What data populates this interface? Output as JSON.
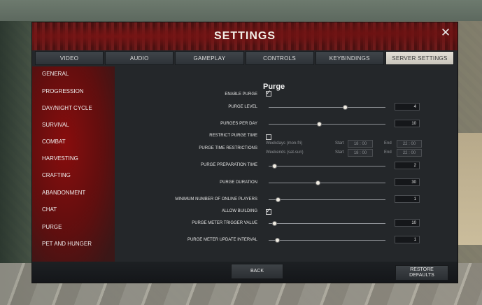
{
  "window": {
    "title": "SETTINGS",
    "close_icon": "✕"
  },
  "tabs": [
    {
      "label": "VIDEO"
    },
    {
      "label": "AUDIO"
    },
    {
      "label": "GAMEPLAY"
    },
    {
      "label": "CONTROLS"
    },
    {
      "label": "KEYBINDINGS"
    },
    {
      "label": "SERVER SETTINGS",
      "active": true
    }
  ],
  "sidebar": {
    "items": [
      {
        "label": "GENERAL"
      },
      {
        "label": "PROGRESSION"
      },
      {
        "label": "DAY/NIGHT CYCLE"
      },
      {
        "label": "SURVIVAL"
      },
      {
        "label": "COMBAT"
      },
      {
        "label": "HARVESTING"
      },
      {
        "label": "CRAFTING"
      },
      {
        "label": "ABANDONMENT"
      },
      {
        "label": "CHAT"
      },
      {
        "label": "PURGE",
        "active": true
      },
      {
        "label": "PET AND HUNGER"
      }
    ]
  },
  "section": {
    "title": "Purge",
    "enable_purge": {
      "label": "ENABLE PURGE",
      "checked": true
    },
    "purge_level": {
      "label": "PURGE LEVEL",
      "value": "4",
      "fraction": 0.65
    },
    "purges_per_day": {
      "label": "PURGES PER DAY",
      "value": "10",
      "fraction": 0.43
    },
    "restrict_purge_time": {
      "label": "RESTRICT PURGE TIME",
      "checked": false
    },
    "purge_time_restrictions": {
      "label": "PURGE TIME RESTRICTIONS",
      "weekdays": {
        "label": "Weekdays (mon-fri)",
        "start_label": "Start",
        "start": "18 : 00",
        "end_label": "End",
        "end": "22 : 00"
      },
      "weekends": {
        "label": "Weekends (sat-sun)",
        "start_label": "Start",
        "start": "18 : 00",
        "end_label": "End",
        "end": "22 : 00"
      }
    },
    "purge_preparation_time": {
      "label": "PURGE PREPARATION TIME",
      "value": "2",
      "fraction": 0.05
    },
    "purge_duration": {
      "label": "PURGE DURATION",
      "value": "30",
      "fraction": 0.42
    },
    "min_online_players": {
      "label": "MINIMUM NUMBER OF ONLINE PLAYERS",
      "value": "1",
      "fraction": 0.08
    },
    "allow_building": {
      "label": "ALLOW BUILDING",
      "checked": true
    },
    "trigger_value": {
      "label": "PURGE METER TRIGGER VALUE",
      "value": "10",
      "fraction": 0.05
    },
    "update_interval": {
      "label": "PURGE METER UPDATE INTERVAL",
      "value": "1",
      "fraction": 0.07
    }
  },
  "footer": {
    "back_label": "BACK",
    "restore_label_line1": "RESTORE",
    "restore_label_line2": "DEFAULTS"
  }
}
